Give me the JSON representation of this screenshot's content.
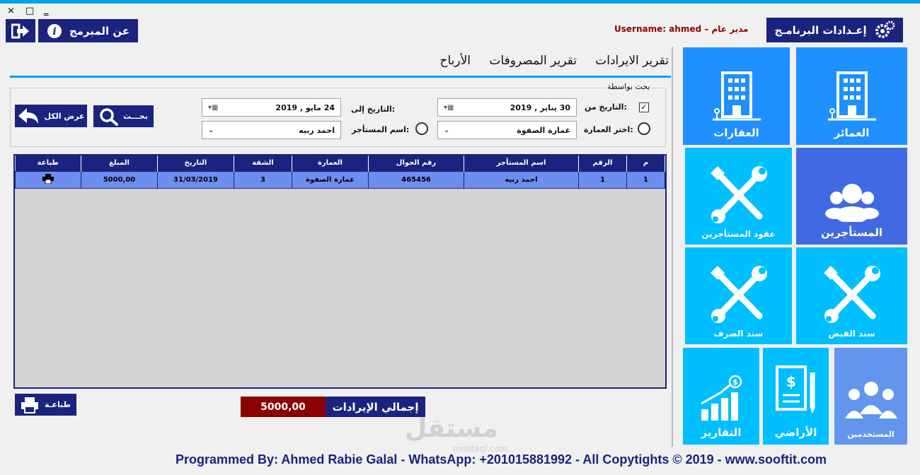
{
  "window": {
    "close": "×",
    "restore": "□",
    "minimize": "‗"
  },
  "header": {
    "about_label": "عن المبرمج",
    "settings_label": "إعـدادات البرنامـج",
    "user_info": "مدير عام – Username: ahmed"
  },
  "tabs": [
    {
      "label": "تقرير الايرادات",
      "active": true
    },
    {
      "label": "تقرير المصروفات",
      "active": false
    },
    {
      "label": "الأرباح",
      "active": false
    }
  ],
  "search": {
    "legend": "بحث بواسطة",
    "date_from_label": "التاريخ من:",
    "date_from_value": "30   يناير  ,  2019",
    "date_from_checked": "✓",
    "date_to_label": "التاريخ إلى:",
    "date_to_value": "24   مايو  ,  2019",
    "building_label": "اختر العمارة:",
    "building_value": "عمارة الصفوة",
    "tenant_label": "اسم المستأجر:",
    "tenant_value": "احمد ربيه",
    "search_button": "بحـــث",
    "show_all_button": "عرض الكل"
  },
  "grid": {
    "columns": [
      "م",
      "الرقم",
      "اسم المستأجر",
      "رقم الجوال",
      "العمارة",
      "الشقة",
      "التاريخ",
      "المبلغ",
      "طباعة"
    ],
    "rows": [
      [
        "1",
        "1",
        "احمد ربيه",
        "465456",
        "عمارة الصفوة",
        "3",
        "31/03/2019",
        "5000,00",
        "printer-icon"
      ]
    ]
  },
  "totals": {
    "print_button": "طباعـة",
    "total_label": "إجمالي الإيرادات",
    "total_value": "5000,00"
  },
  "tiles": {
    "buildings": "العمائر",
    "properties": "العقارات",
    "tenants": "المستأجرين",
    "tenant_contracts": "عقود المستأجرين",
    "receipt_voucher": "سند القبض",
    "payment_voucher": "سند الصرف",
    "users": "المستخدمين",
    "lands": "الأراضي",
    "reports": "التقارير"
  },
  "watermark": {
    "main": "مستقل",
    "sub": "mostaql.com"
  },
  "footer": "Programmed By: Ahmed Rabie Galal - WhatsApp: +201015881992 - All Copytights © 2019 - www.sooftit.com",
  "colors": {
    "navy": "#1a237e",
    "accent": "#00a2e8",
    "tile_blue": "#1e90ff",
    "tile_cyan": "#00bfff",
    "row_blue": "#6d8df0",
    "total_red": "#8b0000"
  }
}
